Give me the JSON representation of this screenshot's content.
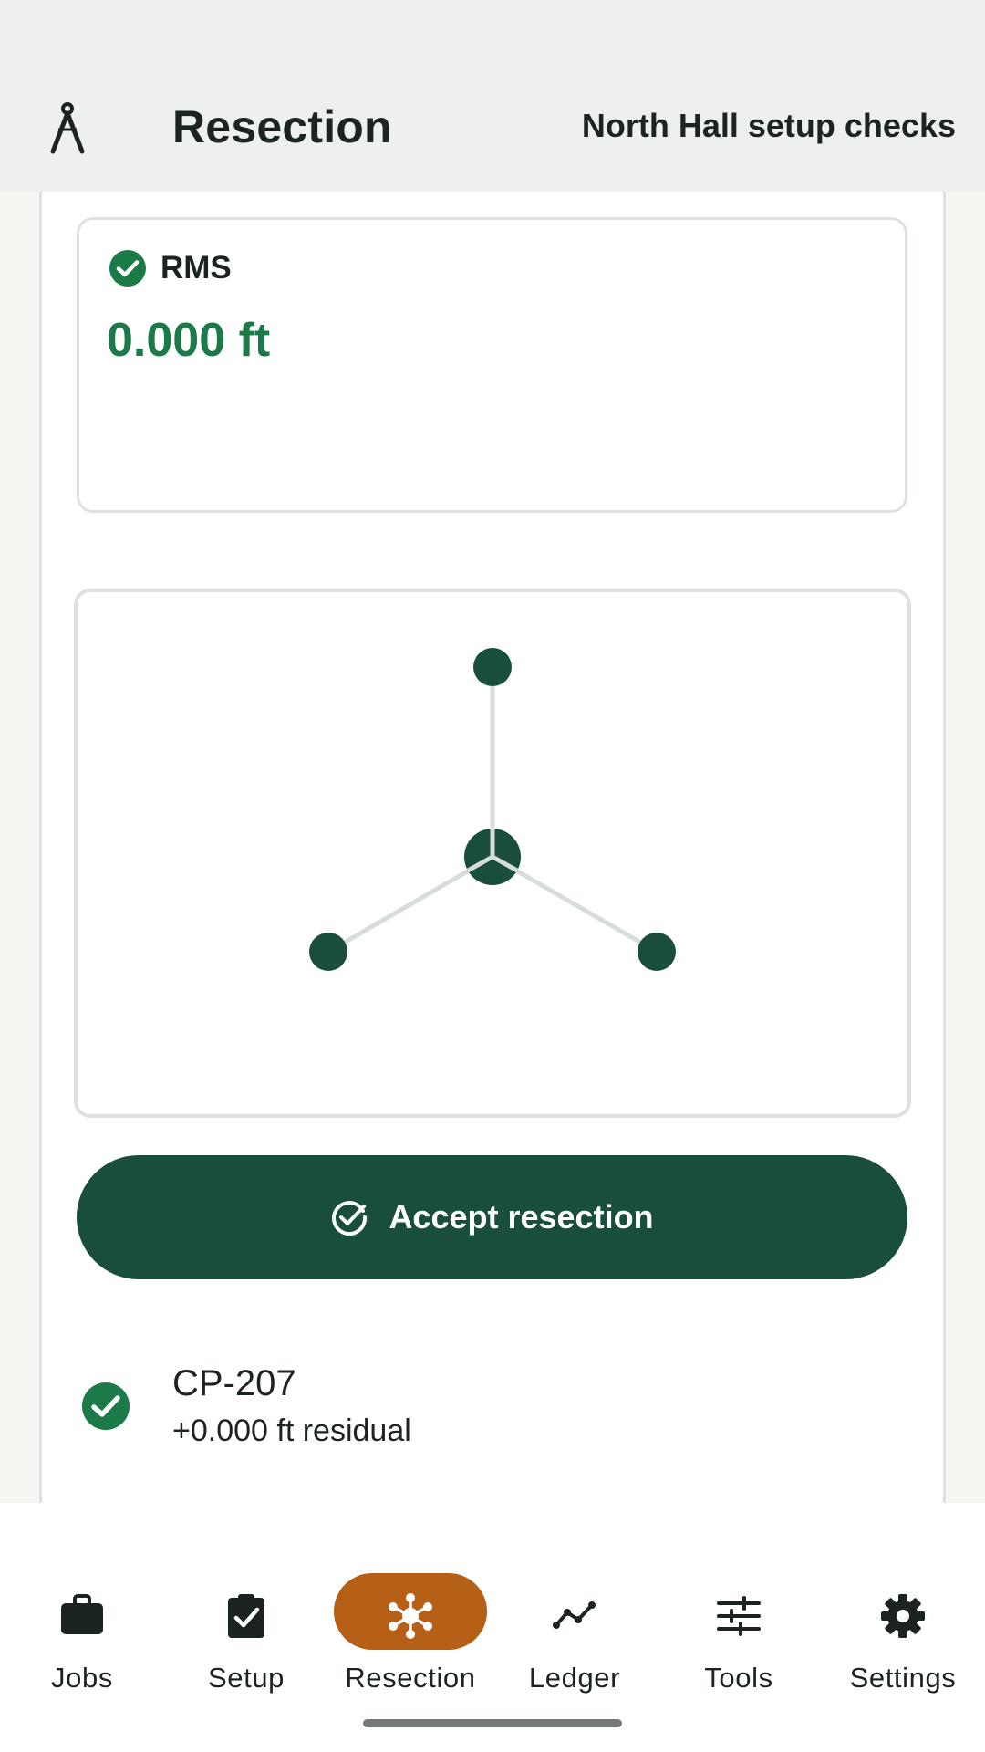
{
  "app_bar": {
    "title": "Resection",
    "subtitle": "North Hall setup checks",
    "icon": "compass-divider-icon"
  },
  "rms": {
    "label": "RMS",
    "value": "0.000 ft",
    "status_icon": "check-circle-icon",
    "value_color": "#1b7a47"
  },
  "diagram": {
    "center_label": "instrument station",
    "points": [
      "top",
      "left",
      "right"
    ],
    "node_color": "#194d3c",
    "line_color": "#d7ded8"
  },
  "accept_button": {
    "label": "Accept resection",
    "icon": "check-circle-outline-icon",
    "background": "#194d3c"
  },
  "points_list": [
    {
      "name": "CP-207",
      "residual": "+0.000 ft residual",
      "status_icon": "check-circle-icon"
    }
  ],
  "bottom_nav": {
    "active": "Resection",
    "active_color": "#b65f17",
    "items": [
      {
        "label": "Jobs",
        "icon": "briefcase-icon"
      },
      {
        "label": "Setup",
        "icon": "clipboard-check-icon"
      },
      {
        "label": "Resection",
        "icon": "hub-icon"
      },
      {
        "label": "Ledger",
        "icon": "trend-line-icon"
      },
      {
        "label": "Tools",
        "icon": "sliders-icon"
      },
      {
        "label": "Settings",
        "icon": "gear-icon"
      }
    ]
  }
}
